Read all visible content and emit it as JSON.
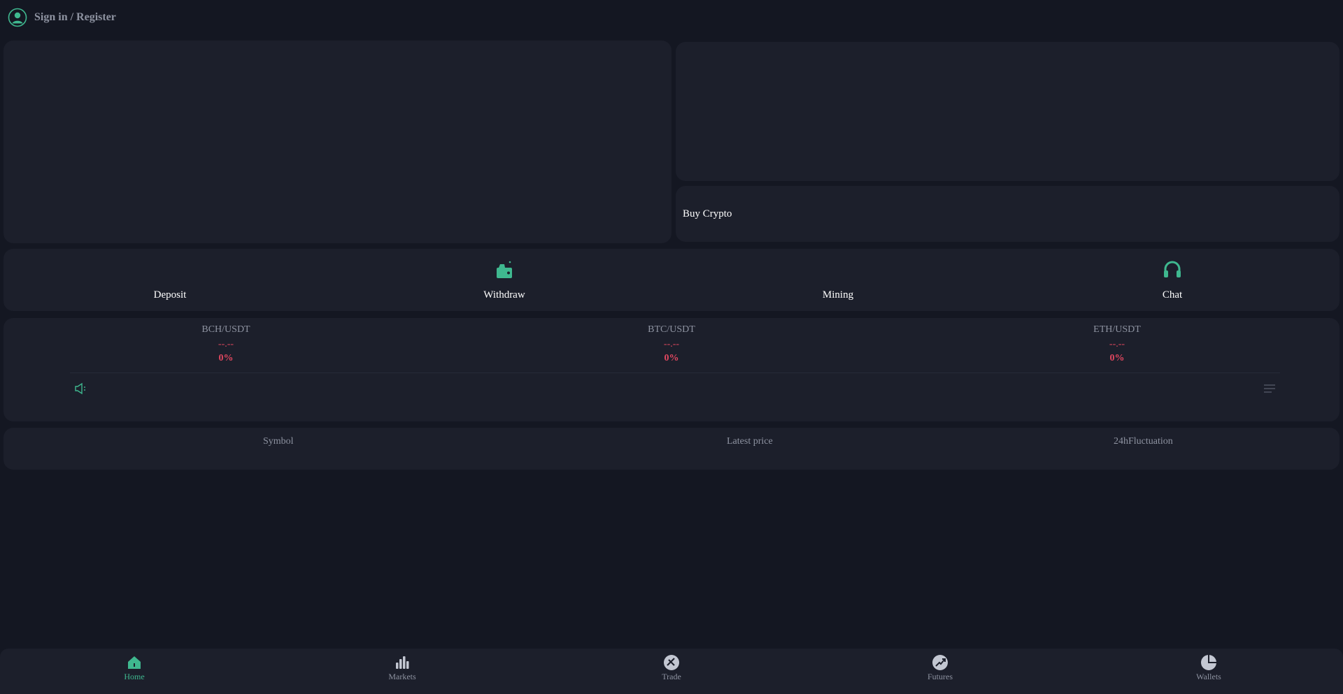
{
  "header": {
    "signin_label": "Sign in / Register"
  },
  "buy_crypto": {
    "label": "Buy Crypto"
  },
  "quick_actions": [
    {
      "label": "Deposit",
      "icon": "deposit-icon"
    },
    {
      "label": "Withdraw",
      "icon": "wallet-icon"
    },
    {
      "label": "Mining",
      "icon": "mining-icon"
    },
    {
      "label": "Chat",
      "icon": "headset-icon"
    }
  ],
  "tickers": [
    {
      "symbol": "BCH/USDT",
      "price": "--.--",
      "change": "0%"
    },
    {
      "symbol": "BTC/USDT",
      "price": "--.--",
      "change": "0%"
    },
    {
      "symbol": "ETH/USDT",
      "price": "--.--",
      "change": "0%"
    }
  ],
  "market_table": {
    "columns": [
      "Symbol",
      "Latest price",
      "24hFluctuation"
    ]
  },
  "bottom_nav": [
    {
      "label": "Home",
      "icon": "home-icon",
      "active": true
    },
    {
      "label": "Markets",
      "icon": "bar-chart-icon",
      "active": false
    },
    {
      "label": "Trade",
      "icon": "trade-icon",
      "active": false
    },
    {
      "label": "Futures",
      "icon": "futures-icon",
      "active": false
    },
    {
      "label": "Wallets",
      "icon": "pie-chart-icon",
      "active": false
    }
  ],
  "colors": {
    "background": "#141722",
    "card": "#1c1f2b",
    "accent": "#3fb88f",
    "negative": "#e0475f",
    "muted_text": "#8e93a1"
  }
}
